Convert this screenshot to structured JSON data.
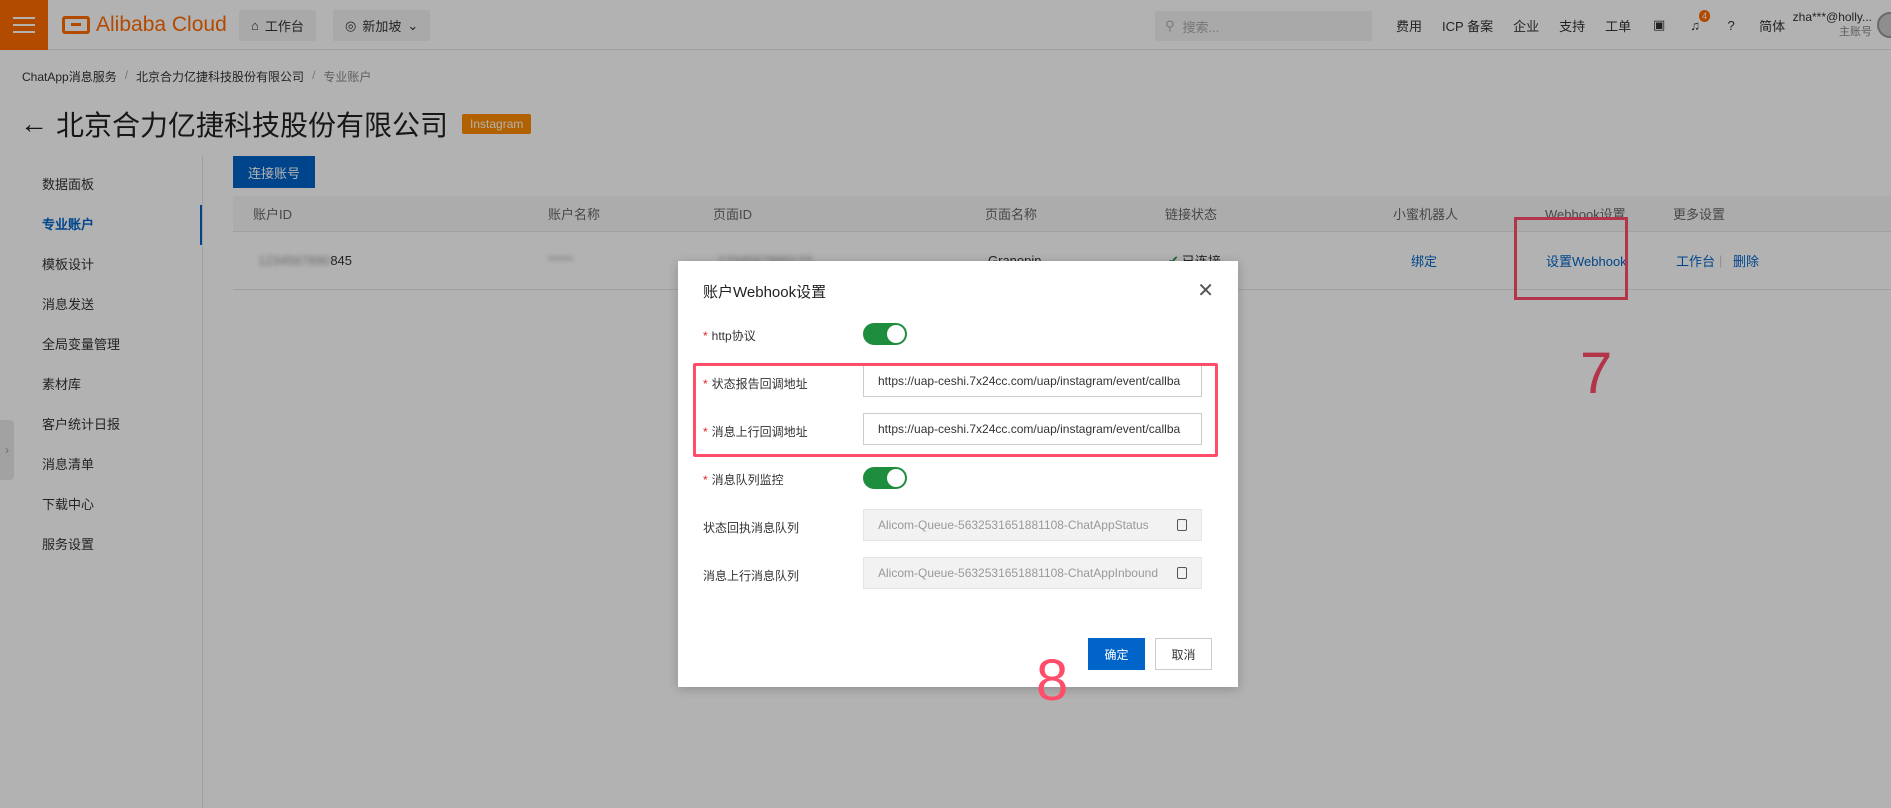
{
  "topbar": {
    "logo": "Alibaba Cloud",
    "workbench": "工作台",
    "region": "新加坡",
    "search_placeholder": "搜索...",
    "links": [
      "费用",
      "ICP 备案",
      "企业",
      "支持",
      "工单"
    ],
    "notification_count": "4",
    "language": "简体",
    "user_name": "zha***@holly...",
    "user_role": "主账号"
  },
  "breadcrumb": [
    "ChatApp消息服务",
    "北京合力亿捷科技股份有限公司",
    "专业账户"
  ],
  "page": {
    "title": "北京合力亿捷科技股份有限公司",
    "tag": "Instagram"
  },
  "sidebar": {
    "items": [
      "数据面板",
      "专业账户",
      "模板设计",
      "消息发送",
      "全局变量管理",
      "素材库",
      "客户统计日报",
      "消息清单",
      "下载中心",
      "服务设置"
    ],
    "active_index": 1
  },
  "content": {
    "connect_button": "连接账号",
    "columns": [
      "账户ID",
      "账户名称",
      "页面ID",
      "页面名称",
      "链接状态",
      "小蜜机器人",
      "Webhook设置",
      "更多设置"
    ],
    "row": {
      "account_id_masked": "1234567890",
      "account_id_suffix": "845",
      "account_name": "*****",
      "page_id": "1234567890123",
      "page_name": "Granopin",
      "link_status": "已连接",
      "bot_action": "绑定",
      "webhook_action": "设置Webhook",
      "more_actions": [
        "工作台",
        "删除"
      ]
    }
  },
  "annotations": {
    "step7": "7",
    "step8": "8"
  },
  "modal": {
    "title": "账户Webhook设置",
    "http_label": "http协议",
    "http_enabled": true,
    "status_callback_label": "状态报告回调地址",
    "status_callback_value": "https://uap-ceshi.7x24cc.com/uap/instagram/event/callba",
    "inbound_callback_label": "消息上行回调地址",
    "inbound_callback_value": "https://uap-ceshi.7x24cc.com/uap/instagram/event/callba",
    "queue_monitor_label": "消息队列监控",
    "queue_monitor_enabled": true,
    "status_queue_label": "状态回执消息队列",
    "status_queue_value": "Alicom-Queue-5632531651881108-ChatAppStatus",
    "inbound_queue_label": "消息上行消息队列",
    "inbound_queue_value": "Alicom-Queue-5632531651881108-ChatAppInbound",
    "ok": "确定",
    "cancel": "取消"
  },
  "colors": {
    "brand": "#ff6a00",
    "primary": "#0064c8",
    "toggle_on": "#1e8e3e",
    "annotation": "#ff4d6a"
  }
}
